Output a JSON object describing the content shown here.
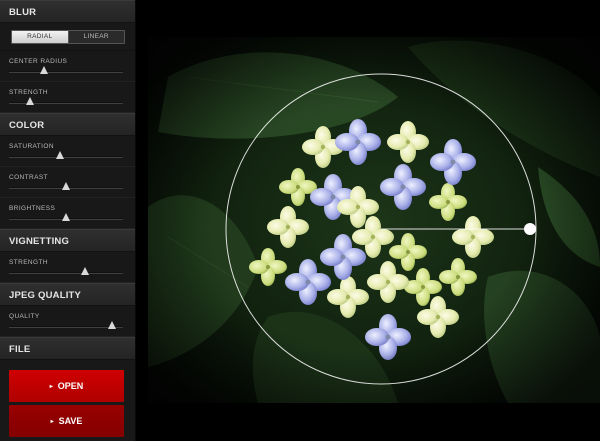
{
  "sidebar": {
    "blur": {
      "title": "BLUR",
      "mode_radial": "RADIAL",
      "mode_linear": "LINEAR",
      "selected_mode": "RADIAL",
      "center_radius": {
        "label": "CENTER RADIUS",
        "value": 0.31
      },
      "strength": {
        "label": "STRENGTH",
        "value": 0.18
      }
    },
    "color": {
      "title": "COLOR",
      "saturation": {
        "label": "SATURATION",
        "value": 0.45
      },
      "contrast": {
        "label": "CONTRAST",
        "value": 0.5
      },
      "brightness": {
        "label": "BRIGHTNESS",
        "value": 0.5
      }
    },
    "vignetting": {
      "title": "VIGNETTING",
      "strength": {
        "label": "STRENGTH",
        "value": 0.67
      }
    },
    "jpeg_quality": {
      "title": "JPEG QUALITY",
      "quality": {
        "label": "QUALITY",
        "value": 0.9
      }
    },
    "file": {
      "title": "FILE",
      "open_label": "OPEN",
      "save_label": "SAVE"
    }
  },
  "colors": {
    "accent_open": "#d00000",
    "accent_save": "#990000",
    "overlay_line": "#ffffff"
  },
  "icons": {
    "open_arrow": "▸",
    "save_arrow": "▸"
  }
}
